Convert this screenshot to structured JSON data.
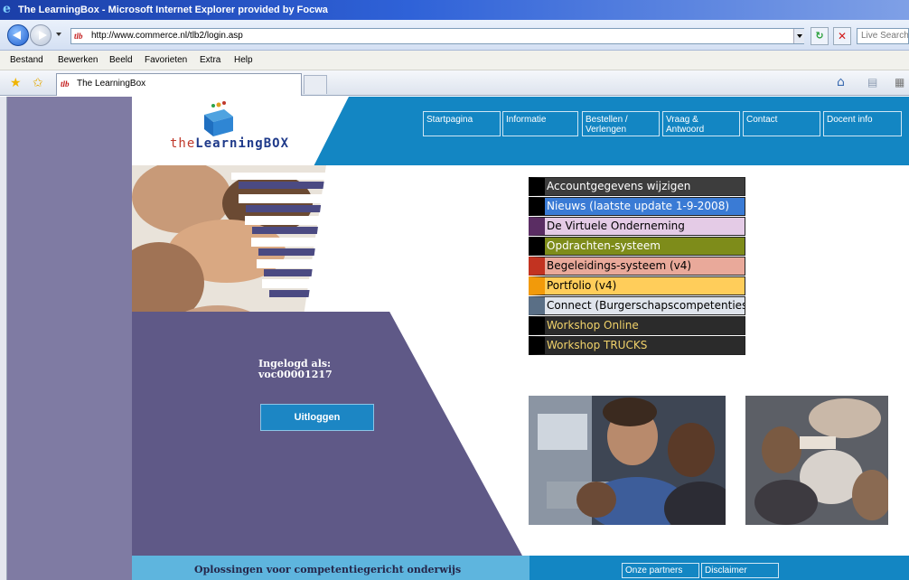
{
  "window": {
    "title": "The LearningBox - Microsoft Internet Explorer provided by Focwa"
  },
  "address": {
    "url": "http://www.commerce.nl/tlb2/login.asp",
    "favicon_text": "tlb"
  },
  "search": {
    "placeholder": "Live Search"
  },
  "menubar": {
    "items": [
      "Bestand",
      "Bewerken",
      "Beeld",
      "Favorieten",
      "Extra",
      "Help"
    ]
  },
  "tab": {
    "title": "The LearningBox"
  },
  "logo": {
    "prefix": "the",
    "name": "LearningBOX"
  },
  "topnav": [
    {
      "label": "Startpagina"
    },
    {
      "label": "Informatie"
    },
    {
      "label": "Bestellen / Verlengen"
    },
    {
      "label": "Vraag & Antwoord"
    },
    {
      "label": "Contact"
    },
    {
      "label": "Docent info"
    }
  ],
  "login": {
    "label_line1": "Ingelogd als:",
    "username": "voc00001217",
    "logout": "Uitloggen"
  },
  "menu": [
    {
      "label": "Accountgegevens wijzigen",
      "bg": "#3d3d3d",
      "fg": "#ffffff",
      "marker": "#000000"
    },
    {
      "label": "Nieuws (laatste update 1-9-2008)",
      "bg": "#3a7bd5",
      "fg": "#ffffff",
      "marker": "#000000"
    },
    {
      "label": "De Virtuele Onderneming",
      "bg": "#e4cbe6",
      "fg": "#000000",
      "marker": "#5a2d63"
    },
    {
      "label": "Opdrachten-systeem",
      "bg": "#7e8c1a",
      "fg": "#ffffff",
      "marker": "#000000"
    },
    {
      "label": "Begeleidings-systeem (v4)",
      "bg": "#e9a99a",
      "fg": "#000000",
      "marker": "#c23321"
    },
    {
      "label": "Portfolio (v4)",
      "bg": "#ffcd5a",
      "fg": "#000000",
      "marker": "#f29a0a"
    },
    {
      "label": "Connect (Burgerschapscompetenties)",
      "bg": "#dfe4ec",
      "fg": "#000000",
      "marker": "#5a6f86"
    },
    {
      "label": "Workshop Online",
      "bg": "#2b2b2b",
      "fg": "#f1d26a",
      "marker": "#000000"
    },
    {
      "label": "Workshop TRUCKS",
      "bg": "#2b2b2b",
      "fg": "#f1d26a",
      "marker": "#000000"
    }
  ],
  "footer": {
    "tagline": "Oplossingen voor competentiegericht onderwijs",
    "partners": "Onze partners",
    "disclaimer": "Disclaimer"
  },
  "colors": {
    "brand_blue": "#1386c3",
    "purple": "#5f5987",
    "side_purple": "#7f7ba3",
    "footer_light": "#5eb5de"
  }
}
